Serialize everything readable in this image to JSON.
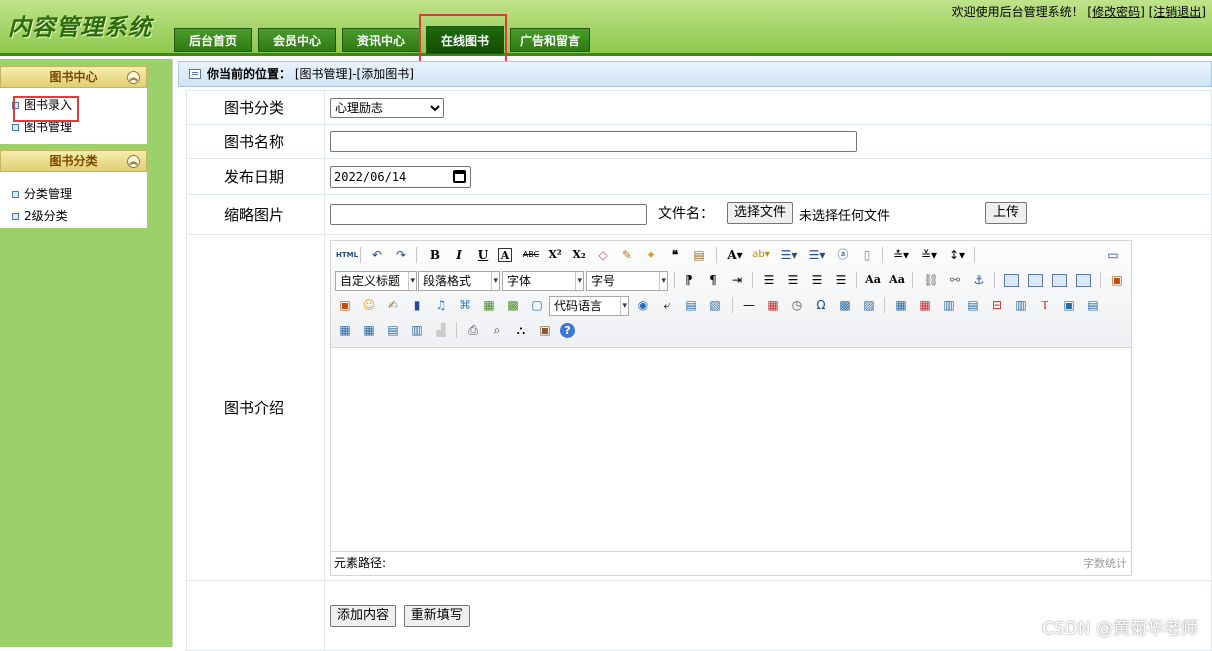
{
  "header": {
    "logo": "内容管理系统",
    "welcome_text": "欢迎使用后台管理系统！",
    "change_password": "[修改密码]",
    "logout": "[注销退出]"
  },
  "nav": {
    "tabs": [
      {
        "label": "后台首页"
      },
      {
        "label": "会员中心"
      },
      {
        "label": "资讯中心"
      },
      {
        "label": "在线图书",
        "active": true
      },
      {
        "label": "广告和留言"
      }
    ]
  },
  "sidebar": {
    "sections": [
      {
        "title": "图书中心",
        "items": [
          "图书录入",
          "图书管理"
        ]
      },
      {
        "title": "图书分类",
        "items": [
          "分类管理",
          "2级分类"
        ]
      }
    ]
  },
  "breadcrumb": {
    "prefix": "你当前的位置：",
    "path": "[图书管理]-[添加图书]"
  },
  "form": {
    "category_label": "图书分类",
    "category_value": "心理励志",
    "name_label": "图书名称",
    "name_value": "",
    "date_label": "发布日期",
    "date_value": "2022/06/14",
    "thumb_label": "缩略图片",
    "thumb_value": "",
    "filename_label": "文件名：",
    "choose_file": "选择文件",
    "no_file": "未选择任何文件",
    "upload": "上传",
    "intro_label": "图书介绍",
    "submit": "添加内容",
    "reset": "重新填写"
  },
  "editor": {
    "selects": [
      "自定义标题",
      "段落格式",
      "字体",
      "字号",
      "代码语言"
    ],
    "status_path": "元素路径:",
    "word_count": "字数统计"
  },
  "watermark": "CSDN @黄菊华老师",
  "colors": {
    "header_green": "#8ec84d",
    "nav_active": "#134d05",
    "sidebar_bg": "#9cd169",
    "highlight": "#e23a3a"
  }
}
